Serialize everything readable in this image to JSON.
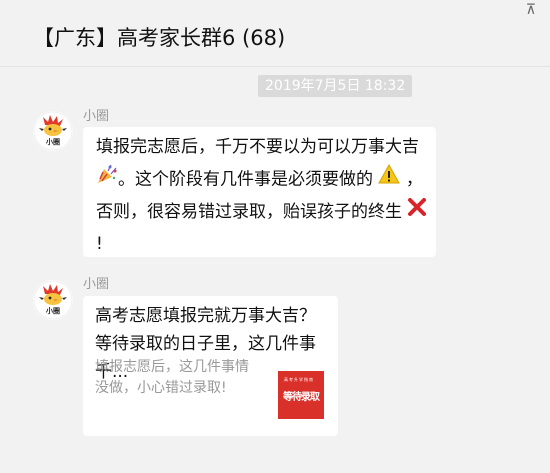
{
  "header": {
    "title": "【广东】高考家长群6 (68)",
    "pin_glyph": "⊼"
  },
  "timestamp": "2019年7月5日 18:32",
  "messages": [
    {
      "sender": "小圈",
      "avatar_label": "小圈",
      "lines": [
        "填报完志愿后，千万不要以为可以万事大吉",
        "。这个阶段有几件事是必须要做的",
        "，",
        "否则，很容易错过录取，贻误孩子的终生",
        "!"
      ],
      "emoji": [
        "party-popper-icon",
        "warning-icon",
        "cross-mark-icon"
      ]
    },
    {
      "sender": "小圈",
      "avatar_label": "小圈",
      "card": {
        "title": "高考志愿填报完就万事大吉？等待录取的日子里，这几件事千...",
        "description": "填报志愿后，这几件事情没做，小心错过录取!",
        "thumb_header": "高考升学指南",
        "thumb_text": "等待录取"
      }
    }
  ],
  "colors": {
    "background": "#f2f2f2",
    "bubble": "#ffffff",
    "timestamp_bg": "#dadada",
    "thumb_red": "#d9302a",
    "muted_text": "#999999"
  }
}
